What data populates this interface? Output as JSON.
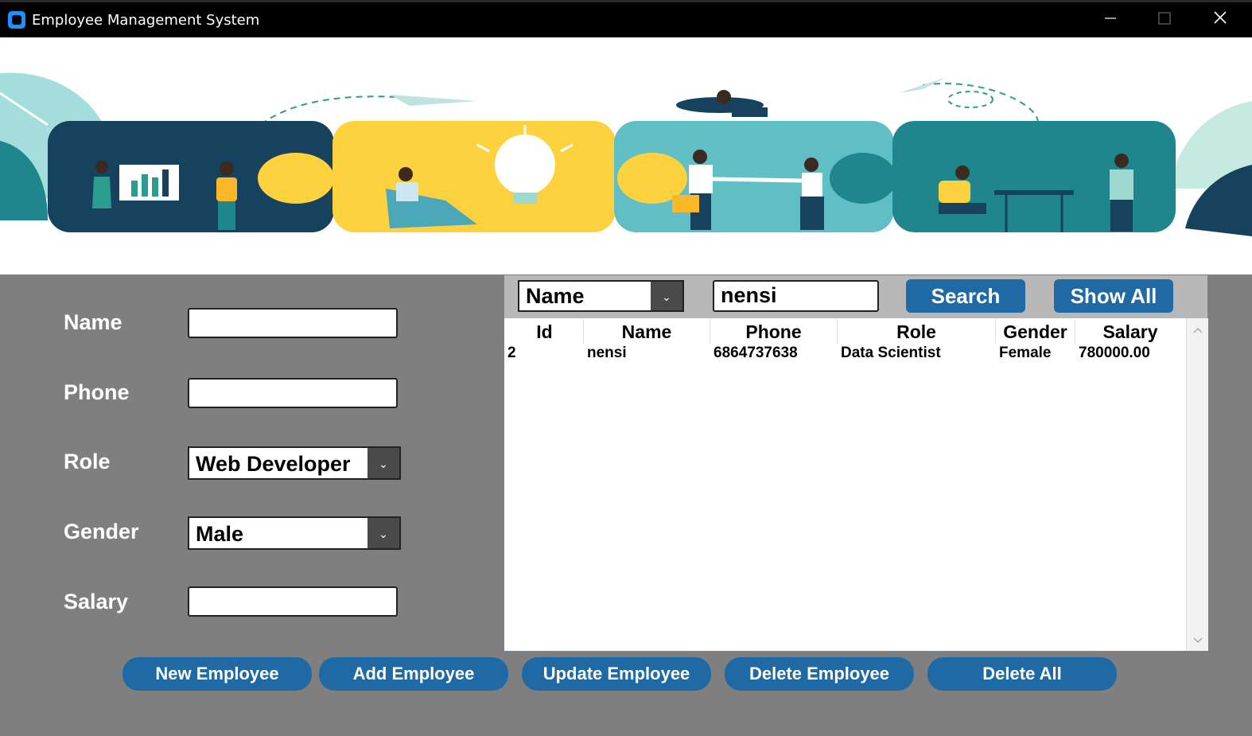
{
  "window": {
    "title": "Employee Management System"
  },
  "form": {
    "name_label": "Name",
    "phone_label": "Phone",
    "role_label": "Role",
    "gender_label": "Gender",
    "salary_label": "Salary",
    "name_value": "",
    "phone_value": "",
    "role_value": "Web Developer",
    "gender_value": "Male",
    "salary_value": ""
  },
  "search": {
    "field_value": "Name",
    "query": "nensi",
    "search_label": "Search",
    "show_all_label": "Show All"
  },
  "table": {
    "headers": [
      "Id",
      "Name",
      "Phone",
      "Role",
      "Gender",
      "Salary"
    ],
    "rows": [
      [
        "2",
        "nensi",
        "6864737638",
        "Data Scientist",
        "Female",
        "780000.00"
      ]
    ]
  },
  "actions": {
    "new": "New Employee",
    "add": "Add Employee",
    "update": "Update Employee",
    "delete": "Delete Employee",
    "delete_all": "Delete All"
  },
  "colors": {
    "accent": "#1f6aa5",
    "background": "#7f7f7f",
    "banner_navy": "#17425d",
    "banner_yellow": "#fdd23e",
    "banner_teal": "#5fbfc4",
    "banner_dark_teal": "#1e868c"
  }
}
